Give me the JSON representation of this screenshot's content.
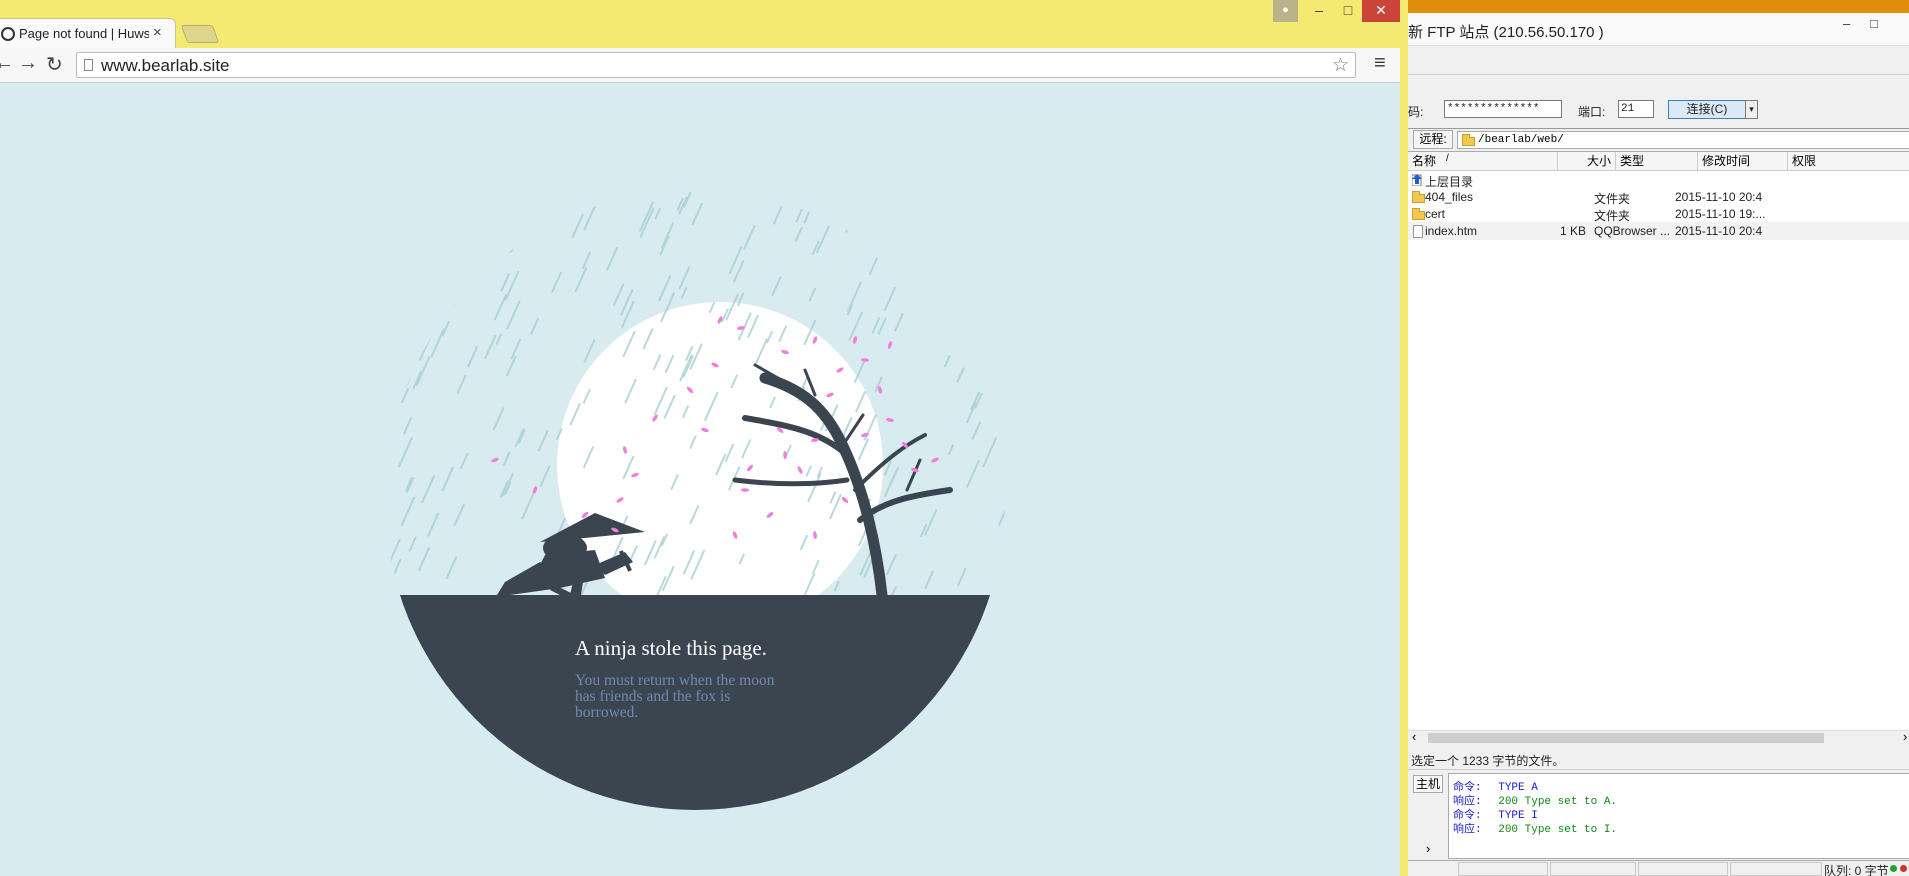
{
  "browser": {
    "tab_title": "Page not found | Huwsh",
    "tab_close": "×",
    "url": "www.bearlab.site",
    "window_controls": {
      "user": "●",
      "minimize": "–",
      "maximize": "□",
      "close": "✕"
    },
    "nav": {
      "back": "←",
      "forward": "→",
      "reload": "↻"
    },
    "star": "☆",
    "menu": "≡",
    "page": {
      "heading": "A ninja stole this page.",
      "message": "You must return when the moon has friends and the fox is borrowed."
    },
    "colors": {
      "titlebar": "#f4ea72",
      "page_bg": "#d8ebee",
      "ground": "#3b4550",
      "moon": "#ffffff",
      "petal": "#f27de0",
      "rain": "#a9d0d3"
    }
  },
  "ftp": {
    "title": "新 FTP 站点 (210.56.50.170 )",
    "window_controls": {
      "minimize": "–",
      "maximize": "□"
    },
    "connection": {
      "password_label": "码:",
      "password_value": "**************",
      "port_label": "端口:",
      "port_value": "21",
      "connect_label": "连接(C)",
      "connect_dropdown": "▾"
    },
    "remote_label": "远程:",
    "remote_path": "/bearlab/web/",
    "columns": {
      "name": "名称",
      "sort_indicator": "/",
      "size": "大小",
      "type": "类型",
      "modified": "修改时间",
      "perms": "权限"
    },
    "rows": [
      {
        "name": "上层目录",
        "size": "",
        "type": "",
        "modified": "",
        "icon": "up-arrow-icon"
      },
      {
        "name": "404_files",
        "size": "",
        "type": "文件夹",
        "modified": "2015-11-10 20:4",
        "icon": "folder-icon"
      },
      {
        "name": "cert",
        "size": "",
        "type": "文件夹",
        "modified": "2015-11-10 19:...",
        "icon": "folder-icon"
      },
      {
        "name": "index.htm",
        "size": "1 KB",
        "type": "QQBrowser ...",
        "modified": "2015-11-10 20:4",
        "icon": "file-icon"
      }
    ],
    "scroll": {
      "left": "‹",
      "right": "›"
    },
    "status": "选定一个 1233 字节的文件。",
    "log": {
      "host_tab": "主机",
      "expand": "›",
      "lines": [
        {
          "key": "命令:",
          "value": "TYPE A",
          "kind": "cmd"
        },
        {
          "key": "响应:",
          "value": "200 Type set to A.",
          "kind": "resp"
        },
        {
          "key": "命令:",
          "value": "TYPE I",
          "kind": "cmd"
        },
        {
          "key": "响应:",
          "value": "200 Type set to I.",
          "kind": "resp"
        }
      ]
    },
    "queue": "队列: 0 字节"
  }
}
